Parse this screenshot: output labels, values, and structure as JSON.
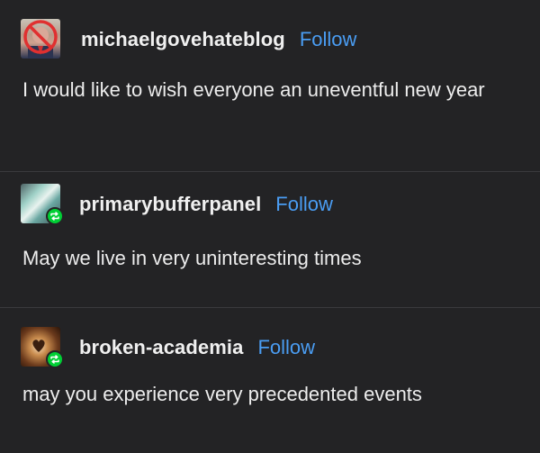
{
  "posts": [
    {
      "username": "michaelgovehateblog",
      "follow_label": "Follow",
      "avatar_icon": "user-avatar-icon",
      "text": "I would like to wish everyone an uneventful new year"
    },
    {
      "username": "primarybufferpanel",
      "follow_label": "Follow",
      "avatar_icon": "user-avatar-icon",
      "reblog_icon": "reblog-icon",
      "text": "May we live in very uninteresting times"
    },
    {
      "username": "broken-academia",
      "follow_label": "Follow",
      "avatar_icon": "user-avatar-icon",
      "reblog_icon": "reblog-icon",
      "text": "may you experience very precedented events"
    }
  ],
  "colors": {
    "background": "#232325",
    "follow": "#4a9df3",
    "reblog_badge": "#00cf35",
    "divider": "#3a3a3d"
  }
}
